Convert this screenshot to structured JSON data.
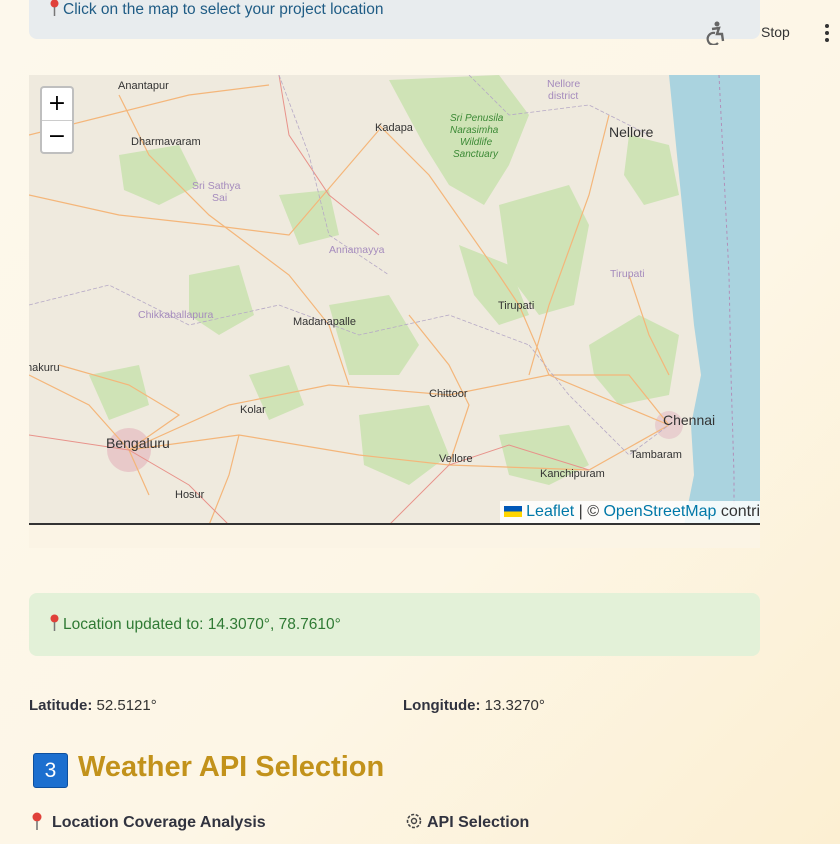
{
  "top_info": {
    "text": "Click on the map to select your project location"
  },
  "status": {
    "stop_label": "Stop"
  },
  "map": {
    "zoom_in": "+",
    "zoom_out": "−",
    "attribution": {
      "leaflet": "Leaflet",
      "sep": " | © ",
      "osm": "OpenStreetMap",
      "tail": " contri"
    },
    "places": {
      "anantapur": "Anantapur",
      "dharmavaram": "Dharmavaram",
      "sri_sathya": "Sri Sathya",
      "sai": "Sai",
      "kadapa": "Kadapa",
      "nellore_district": "Nellore",
      "district": "district",
      "nellore": "Nellore",
      "sri_penusila": "Sri Penusila",
      "narasimha": "Narasimha",
      "wildlife": "Wildlife",
      "sanctuary": "Sanctuary",
      "annamayya": "Annamayya",
      "tirupati_district": "Tirupati",
      "tirupati": "Tirupati",
      "chikkaballapura": "Chikkaballapura",
      "madanapalle": "Madanapalle",
      "makuru": "makuru",
      "chittoor": "Chittoor",
      "kolar": "Kolar",
      "chennai": "Chennai",
      "bengaluru": "Bengaluru",
      "vellore": "Vellore",
      "tambaram": "Tambaram",
      "kanchipuram": "Kanchipuram",
      "hosur": "Hosur"
    }
  },
  "success": {
    "text": "Location updated to: 14.3070°, 78.7610°"
  },
  "coords": {
    "lat_label": "Latitude:",
    "lat_value": " 52.5121°",
    "lon_label": "Longitude:",
    "lon_value": " 13.3270°"
  },
  "section": {
    "number": "3",
    "title": "Weather API Selection"
  },
  "subheaders": {
    "coverage": "Location Coverage Analysis",
    "api": "API Selection"
  },
  "colors": {
    "accent_title": "#c2921b",
    "success_text": "#2f7a34",
    "info_text": "#1f5c85",
    "water": "#aad3df"
  }
}
